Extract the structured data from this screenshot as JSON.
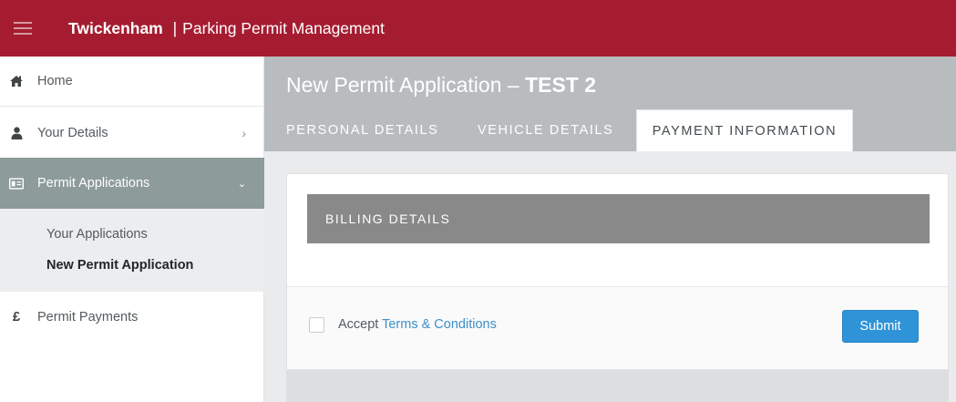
{
  "header": {
    "brand": "Twickenham",
    "separator": "|",
    "subtitle": "Parking Permit Management",
    "menu_icon": "hamburger-icon",
    "bg_color": "#a51c30"
  },
  "sidebar": {
    "items": [
      {
        "label": "Home",
        "icon": "home-icon"
      },
      {
        "label": "Your Details",
        "icon": "user-icon",
        "chevron": "›"
      },
      {
        "label": "Permit Applications",
        "icon": "id-card-icon",
        "chevron": "⌄",
        "active": true,
        "children": [
          {
            "label": "Your Applications"
          },
          {
            "label": "New Permit Application",
            "current": true
          }
        ]
      },
      {
        "label": "Permit Payments",
        "icon": "pound-icon",
        "glyph": "£"
      }
    ],
    "active_color": "#8d9b9a"
  },
  "main": {
    "title_prefix": "New Permit Application – ",
    "title_strong": "TEST 2",
    "tabs": [
      {
        "label": "PERSONAL DETAILS"
      },
      {
        "label": "VEHICLE DETAILS"
      },
      {
        "label": "PAYMENT INFORMATION",
        "active": true
      }
    ],
    "billing": {
      "heading": "BILLING DETAILS"
    },
    "footer": {
      "accept_text": "Accept ",
      "terms_link": "Terms & Conditions",
      "submit_label": "Submit",
      "accent_color": "#2f93d8"
    }
  }
}
